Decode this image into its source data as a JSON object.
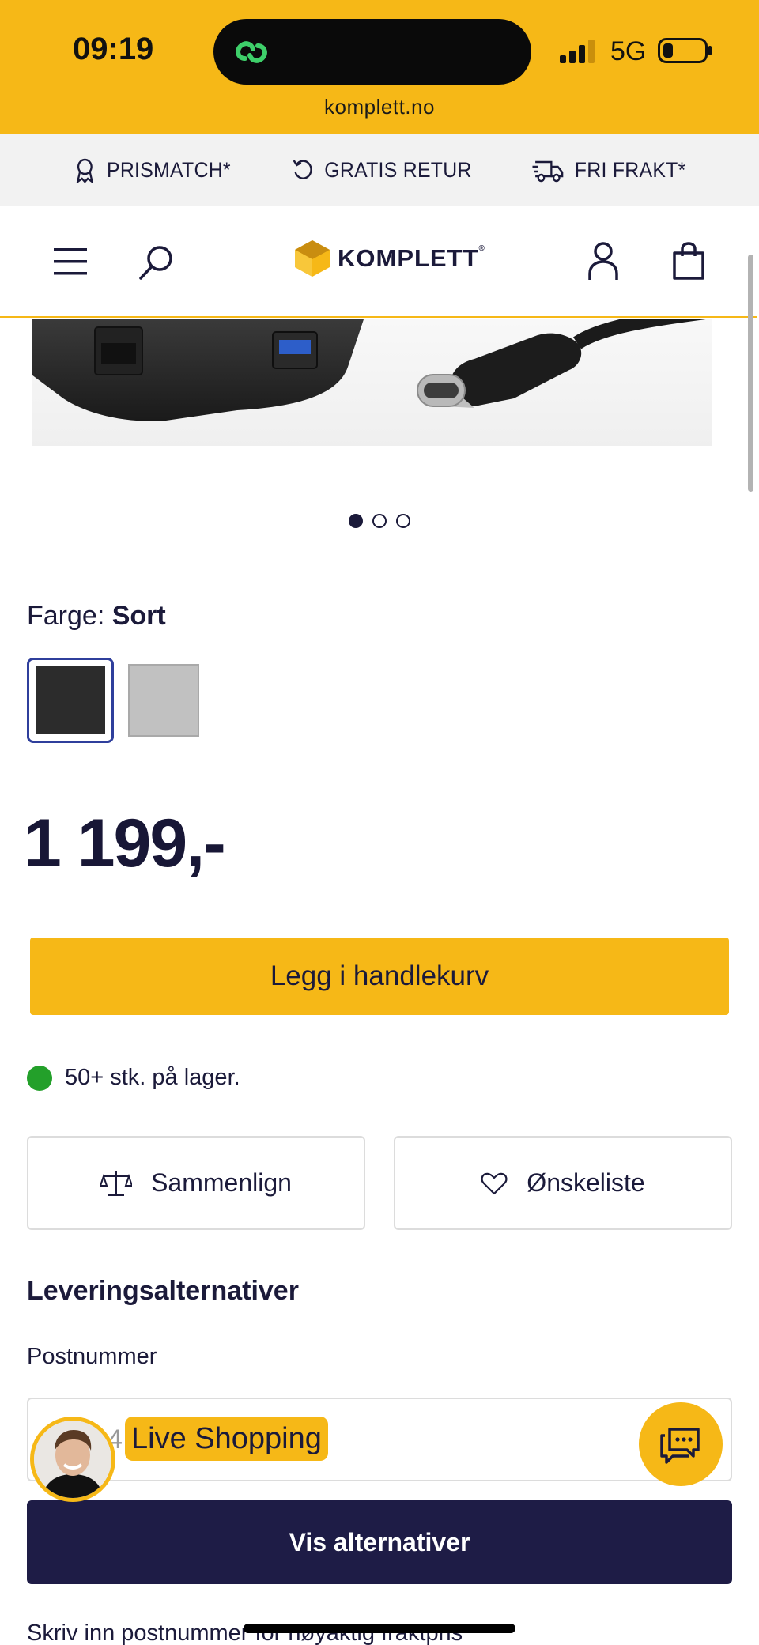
{
  "status_bar": {
    "time": "09:19",
    "network": "5G",
    "url": "komplett.no",
    "island_icon": "link-icon",
    "colors": {
      "background": "#f6b817"
    }
  },
  "usp_bar": {
    "items": [
      {
        "icon": "award-icon",
        "label": "PRISMATCH*"
      },
      {
        "icon": "return-icon",
        "label": "GRATIS RETUR"
      },
      {
        "icon": "truck-icon",
        "label": "FRI FRAKT*"
      }
    ]
  },
  "header": {
    "logo_text": "KOMPLETT",
    "logo_reg": "®",
    "icons": [
      "menu-icon",
      "search-icon",
      "account-icon",
      "cart-icon"
    ]
  },
  "gallery": {
    "image": "usb-c-hub-image",
    "dots_count": 3,
    "active_dot": 1
  },
  "product": {
    "color_label": "Farge:",
    "color_value": "Sort",
    "swatches": [
      {
        "name": "Sort",
        "color": "#2c2c2c",
        "selected": true
      },
      {
        "name": "Grå",
        "color": "#c1c1c1",
        "selected": false
      }
    ],
    "price": "1 199,-",
    "add_to_cart": "Legg i handlekurv",
    "stock_text": "50+ stk. på lager.",
    "stock_color": "#23a02a",
    "compare_label": "Sammenlign",
    "wishlist_label": "Ønskeliste"
  },
  "delivery": {
    "title": "Leveringsalternativer",
    "postal_label": "Postnummer",
    "postal_value": "4",
    "button_label": "Vis alternativer",
    "hint": "Skriv inn postnummer for nøyaktig fraktpris"
  },
  "overlay": {
    "live_label": "Live Shopping",
    "chat_icon": "chat-icon"
  },
  "colors": {
    "accent": "#f6b817",
    "navy": "#1e1c46",
    "text": "#1b1a3a"
  }
}
